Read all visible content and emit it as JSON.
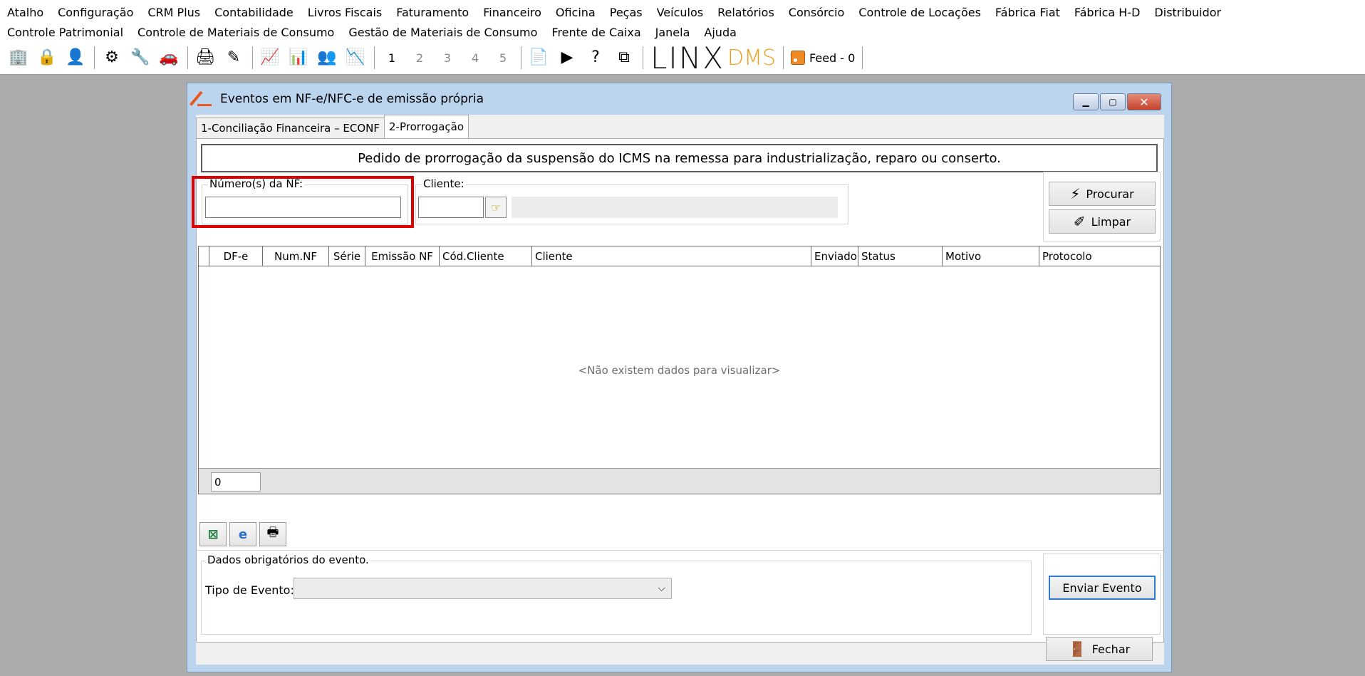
{
  "menu": {
    "row1": [
      "Atalho",
      "Configuração",
      "CRM Plus",
      "Contabilidade",
      "Livros Fiscais",
      "Faturamento",
      "Financeiro",
      "Oficina",
      "Peças",
      "Veículos",
      "Relatórios",
      "Consórcio",
      "Controle de Locações",
      "Fábrica Fiat",
      "Fábrica H-D",
      "Distribuidor"
    ],
    "row2": [
      "Controle Patrimonial",
      "Controle de Materiais de Consumo",
      "Gestão de Materiais de Consumo",
      "Frente de Caixa",
      "Janela",
      "Ajuda"
    ]
  },
  "toolbar": {
    "numbers": [
      "1",
      "2",
      "3",
      "4",
      "5"
    ],
    "logo": "LINX",
    "logo_suffix": "DMS",
    "feed_label": "Feed - 0"
  },
  "window": {
    "title": "Eventos em NF-e/NFC-e de emissão própria",
    "tabs": [
      "1-Conciliação Financeira – ECONF",
      "2-Prorrogação"
    ],
    "banner": "Pedido de prorrogação da suspensão do ICMS na remessa para industrialização, reparo ou conserto.",
    "nf_label": "Número(s) da NF:",
    "nf_value": "",
    "client_label": "Cliente:",
    "client_value": "",
    "search_button": "Procurar",
    "clear_button": "Limpar",
    "grid_columns": [
      "DF-e",
      "Num.NF",
      "Série",
      "Emissão NF",
      "Cód.Cliente",
      "Cliente",
      "Enviado",
      "Status",
      "Motivo",
      "Protocolo"
    ],
    "empty_message": "<Não existem dados para visualizar>",
    "row_count": "0",
    "event_group_label": "Dados obrigatórios do evento.",
    "event_type_label": "Tipo de Evento:",
    "event_type_value": "",
    "send_button": "Enviar Evento",
    "close_button": "Fechar"
  }
}
